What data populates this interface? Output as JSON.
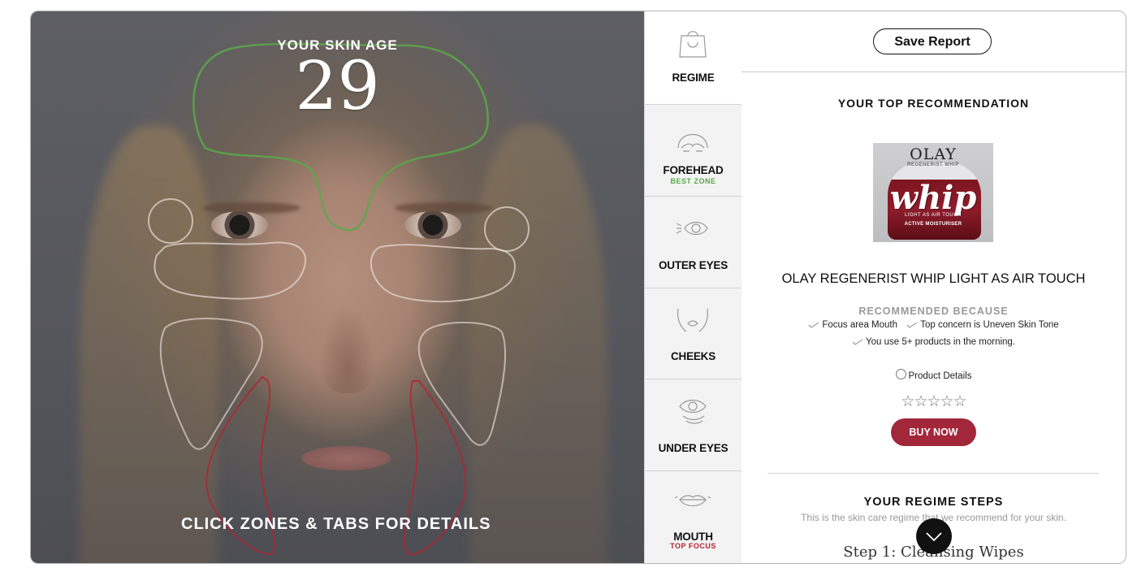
{
  "analysis": {
    "skin_age_label": "YOUR SKIN AGE",
    "skin_age_value": "29",
    "hint": "CLICK ZONES & TABS FOR DETAILS"
  },
  "colors": {
    "best_zone": "#5aa84a",
    "top_focus": "#b3232f",
    "buy_button": "#a2273a",
    "zone_outline_neutral": "#e8ddd6"
  },
  "tabs": [
    {
      "label": "REGIME",
      "sub": "",
      "icon": "shopping-bag-icon",
      "active": true
    },
    {
      "label": "FOREHEAD",
      "sub": "BEST ZONE",
      "icon": "forehead-icon",
      "active": false
    },
    {
      "label": "OUTER EYES",
      "sub": "",
      "icon": "outer-eye-icon",
      "active": false
    },
    {
      "label": "CHEEKS",
      "sub": "",
      "icon": "cheeks-icon",
      "active": false
    },
    {
      "label": "UNDER EYES",
      "sub": "",
      "icon": "under-eye-icon",
      "active": false
    },
    {
      "label": "MOUTH",
      "sub": "TOP FOCUS",
      "icon": "mouth-icon",
      "active": false
    }
  ],
  "report": {
    "save_label": "Save Report",
    "top_recommendation_title": "YOUR TOP RECOMMENDATION",
    "product": {
      "image_brand": "OLAY",
      "image_sub": "REGENERIST WHIP",
      "image_script": "whip",
      "image_tag": "LIGHT AS AIR TOUCH",
      "image_tag2": "ACTIVE MOISTURISER",
      "name": "OLAY REGENERIST WHIP LIGHT AS AIR TOUCH"
    },
    "recommended_because_title": "RECOMMENDED BECAUSE",
    "reasons": [
      "Focus area Mouth",
      "Top concern is Uneven Skin Tone",
      "You use 5+ products in the morning."
    ],
    "product_details_label": "Product Details",
    "rating": 0,
    "rating_max": 5,
    "stars_text": "☆☆☆☆☆",
    "buy_label": "BUY NOW",
    "regime_title": "YOUR REGIME STEPS",
    "regime_subtitle": "This is the skin care regime that we recommend for your skin.",
    "step_1": "Step 1: Cleansing Wipes"
  }
}
